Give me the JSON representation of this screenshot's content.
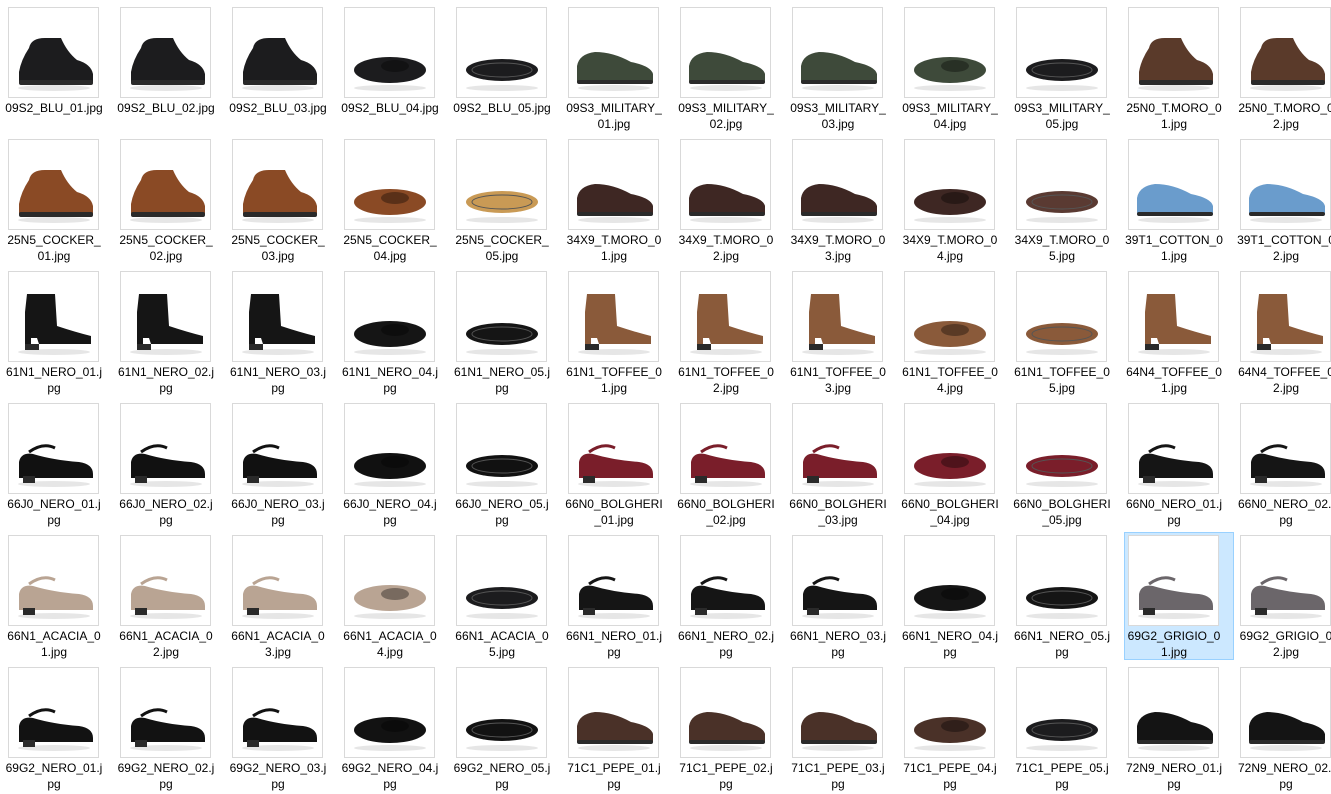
{
  "explorer": {
    "selected_file": "69G2_GRIGIO_01.jpg",
    "files": [
      {
        "name": "09S2_BLU_01.jpg",
        "icon": "black-ankle-boot-side-thumbnail",
        "color": "#1c1c1e"
      },
      {
        "name": "09S2_BLU_02.jpg",
        "icon": "black-ankle-boot-angle-thumbnail",
        "color": "#1c1c1e"
      },
      {
        "name": "09S2_BLU_03.jpg",
        "icon": "black-ankle-boot-front-thumbnail",
        "color": "#1c1c1e"
      },
      {
        "name": "09S2_BLU_04.jpg",
        "icon": "black-ankle-boot-top-thumbnail",
        "color": "#1c1c1e"
      },
      {
        "name": "09S2_BLU_05.jpg",
        "icon": "black-ankle-boot-sole-thumbnail",
        "color": "#1c1c1e"
      },
      {
        "name": "09S3_MILITARY_01.jpg",
        "icon": "green-sneaker-side-thumbnail",
        "color": "#3e4a3a"
      },
      {
        "name": "09S3_MILITARY_02.jpg",
        "icon": "green-sneaker-angle-thumbnail",
        "color": "#3e4a3a"
      },
      {
        "name": "09S3_MILITARY_03.jpg",
        "icon": "green-sneaker-front-thumbnail",
        "color": "#3e4a3a"
      },
      {
        "name": "09S3_MILITARY_04.jpg",
        "icon": "green-sneaker-top-thumbnail",
        "color": "#3e4a3a"
      },
      {
        "name": "09S3_MILITARY_05.jpg",
        "icon": "green-sneaker-sole-thumbnail",
        "color": "#1c1c1e"
      },
      {
        "name": "25N0_T.MORO_01.jpg",
        "icon": "brown-desert-boot-side-thumbnail",
        "color": "#5a3a2a"
      },
      {
        "name": "25N0_T.MORO_02.jpg",
        "icon": "brown-desert-boot-angle-thumbnail",
        "color": "#5a3a2a"
      },
      {
        "name": "25N5_COCKER_01.jpg",
        "icon": "cognac-lace-boot-side-thumbnail",
        "color": "#8a4a25"
      },
      {
        "name": "25N5_COCKER_02.jpg",
        "icon": "cognac-lace-boot-angle-thumbnail",
        "color": "#8a4a25"
      },
      {
        "name": "25N5_COCKER_03.jpg",
        "icon": "cognac-lace-boot-front-thumbnail",
        "color": "#8a4a25"
      },
      {
        "name": "25N5_COCKER_04.jpg",
        "icon": "cognac-lace-boot-top-thumbnail",
        "color": "#8a4a25"
      },
      {
        "name": "25N5_COCKER_05.jpg",
        "icon": "cognac-lace-boot-sole-thumbnail",
        "color": "#c99a55"
      },
      {
        "name": "34X9_T.MORO_01.jpg",
        "icon": "woven-tassel-loafer-side-thumbnail",
        "color": "#3e2723"
      },
      {
        "name": "34X9_T.MORO_02.jpg",
        "icon": "woven-tassel-loafer-angle-thumbnail",
        "color": "#3e2723"
      },
      {
        "name": "34X9_T.MORO_03.jpg",
        "icon": "woven-tassel-loafer-front-thumbnail",
        "color": "#3e2723"
      },
      {
        "name": "34X9_T.MORO_04.jpg",
        "icon": "woven-tassel-loafer-top-thumbnail",
        "color": "#3e2723"
      },
      {
        "name": "34X9_T.MORO_05.jpg",
        "icon": "woven-tassel-loafer-sole-thumbnail",
        "color": "#5a3a32"
      },
      {
        "name": "39T1_COTTON_01.jpg",
        "icon": "blue-platform-sneaker-side-thumbnail",
        "color": "#6a9ccc"
      },
      {
        "name": "39T1_COTTON_02.jpg",
        "icon": "blue-platform-sneaker-angle-thumbnail",
        "color": "#6a9ccc"
      },
      {
        "name": "61N1_NERO_01.jpg",
        "icon": "black-heeled-bootie-side-thumbnail",
        "color": "#151515"
      },
      {
        "name": "61N1_NERO_02.jpg",
        "icon": "black-heeled-bootie-angle-thumbnail",
        "color": "#151515"
      },
      {
        "name": "61N1_NERO_03.jpg",
        "icon": "black-heeled-bootie-front-thumbnail",
        "color": "#151515"
      },
      {
        "name": "61N1_NERO_04.jpg",
        "icon": "black-heeled-bootie-top-thumbnail",
        "color": "#151515"
      },
      {
        "name": "61N1_NERO_05.jpg",
        "icon": "black-heeled-bootie-sole-thumbnail",
        "color": "#151515"
      },
      {
        "name": "61N1_TOFFEE_01.jpg",
        "icon": "toffee-heeled-bootie-side-thumbnail",
        "color": "#8a5a3a"
      },
      {
        "name": "61N1_TOFFEE_02.jpg",
        "icon": "toffee-heeled-bootie-angle-thumbnail",
        "color": "#8a5a3a"
      },
      {
        "name": "61N1_TOFFEE_03.jpg",
        "icon": "toffee-heeled-bootie-front-thumbnail",
        "color": "#8a5a3a"
      },
      {
        "name": "61N1_TOFFEE_04.jpg",
        "icon": "toffee-heeled-bootie-top-thumbnail",
        "color": "#8a5a3a"
      },
      {
        "name": "61N1_TOFFEE_05.jpg",
        "icon": "toffee-heeled-bootie-sole-thumbnail",
        "color": "#8a5a3a"
      },
      {
        "name": "64N4_TOFFEE_01.jpg",
        "icon": "toffee-kitten-heel-bootie-side-thumbnail",
        "color": "#8a5a3a"
      },
      {
        "name": "64N4_TOFFEE_02.jpg",
        "icon": "toffee-kitten-heel-bootie-angle-thumbnail",
        "color": "#8a5a3a"
      },
      {
        "name": "66J0_NERO_01.jpg",
        "icon": "black-patent-strap-pump-side-thumbnail",
        "color": "#111111"
      },
      {
        "name": "66J0_NERO_02.jpg",
        "icon": "black-patent-strap-pump-angle-thumbnail",
        "color": "#111111"
      },
      {
        "name": "66J0_NERO_03.jpg",
        "icon": "black-patent-strap-pump-front-thumbnail",
        "color": "#111111"
      },
      {
        "name": "66J0_NERO_04.jpg",
        "icon": "black-patent-strap-pump-top-thumbnail",
        "color": "#111111"
      },
      {
        "name": "66J0_NERO_05.jpg",
        "icon": "black-patent-strap-pump-sole-thumbnail",
        "color": "#111111"
      },
      {
        "name": "66N0_BOLGHERI_01.jpg",
        "icon": "burgundy-strap-pump-side-thumbnail",
        "color": "#7a1e2a"
      },
      {
        "name": "66N0_BOLGHERI_02.jpg",
        "icon": "burgundy-strap-pump-angle-thumbnail",
        "color": "#7a1e2a"
      },
      {
        "name": "66N0_BOLGHERI_03.jpg",
        "icon": "burgundy-strap-pump-front-thumbnail",
        "color": "#7a1e2a"
      },
      {
        "name": "66N0_BOLGHERI_04.jpg",
        "icon": "burgundy-strap-pump-top-thumbnail",
        "color": "#7a1e2a"
      },
      {
        "name": "66N0_BOLGHERI_05.jpg",
        "icon": "burgundy-strap-pump-sole-thumbnail",
        "color": "#7a1e2a"
      },
      {
        "name": "66N0_NERO_01.jpg",
        "icon": "black-strap-pump-side-thumbnail",
        "color": "#151515"
      },
      {
        "name": "66N0_NERO_02.jpg",
        "icon": "black-strap-pump-angle-thumbnail",
        "color": "#151515"
      },
      {
        "name": "66N1_ACACIA_01.jpg",
        "icon": "beige-double-strap-pump-side-thumbnail",
        "color": "#b9a493"
      },
      {
        "name": "66N1_ACACIA_02.jpg",
        "icon": "beige-double-strap-pump-angle-thumbnail",
        "color": "#b9a493"
      },
      {
        "name": "66N1_ACACIA_03.jpg",
        "icon": "beige-double-strap-pump-front-thumbnail",
        "color": "#b9a493"
      },
      {
        "name": "66N1_ACACIA_04.jpg",
        "icon": "beige-double-strap-pump-top-thumbnail",
        "color": "#b9a493"
      },
      {
        "name": "66N1_ACACIA_05.jpg",
        "icon": "beige-double-strap-pump-sole-thumbnail",
        "color": "#1c1c1e"
      },
      {
        "name": "66N1_NERO_01.jpg",
        "icon": "black-double-strap-pump-side-thumbnail",
        "color": "#151515"
      },
      {
        "name": "66N1_NERO_02.jpg",
        "icon": "black-double-strap-pump-angle-thumbnail",
        "color": "#151515"
      },
      {
        "name": "66N1_NERO_03.jpg",
        "icon": "black-double-strap-pump-front-thumbnail",
        "color": "#151515"
      },
      {
        "name": "66N1_NERO_04.jpg",
        "icon": "black-double-strap-pump-top-thumbnail",
        "color": "#151515"
      },
      {
        "name": "66N1_NERO_05.jpg",
        "icon": "black-double-strap-pump-sole-thumbnail",
        "color": "#151515"
      },
      {
        "name": "69G2_GRIGIO_01.jpg",
        "icon": "grey-velvet-ballet-flat-side-thumbnail",
        "color": "#6b666a"
      },
      {
        "name": "69G2_GRIGIO_02.jpg",
        "icon": "grey-velvet-ballet-flat-angle-thumbnail",
        "color": "#6b666a"
      },
      {
        "name": "69G2_NERO_01.jpg",
        "icon": "black-velvet-ballet-flat-side-thumbnail",
        "color": "#121212"
      },
      {
        "name": "69G2_NERO_02.jpg",
        "icon": "black-velvet-ballet-flat-angle-thumbnail",
        "color": "#121212"
      },
      {
        "name": "69G2_NERO_03.jpg",
        "icon": "black-velvet-ballet-flat-front-thumbnail",
        "color": "#121212"
      },
      {
        "name": "69G2_NERO_04.jpg",
        "icon": "black-velvet-ballet-flat-top-thumbnail",
        "color": "#121212"
      },
      {
        "name": "69G2_NERO_05.jpg",
        "icon": "black-velvet-ballet-flat-sole-thumbnail",
        "color": "#121212"
      },
      {
        "name": "71C1_PEPE_01.jpg",
        "icon": "brown-suede-penny-loafer-side-thumbnail",
        "color": "#4a3128"
      },
      {
        "name": "71C1_PEPE_02.jpg",
        "icon": "brown-suede-penny-loafer-angle-thumbnail",
        "color": "#4a3128"
      },
      {
        "name": "71C1_PEPE_03.jpg",
        "icon": "brown-suede-penny-loafer-front-thumbnail",
        "color": "#4a3128"
      },
      {
        "name": "71C1_PEPE_04.jpg",
        "icon": "brown-suede-penny-loafer-top-thumbnail",
        "color": "#4a3128"
      },
      {
        "name": "71C1_PEPE_05.jpg",
        "icon": "brown-suede-penny-loafer-sole-thumbnail",
        "color": "#1c1c1e"
      },
      {
        "name": "72N9_NERO_01.jpg",
        "icon": "black-derby-shoe-side-thumbnail",
        "color": "#141414"
      },
      {
        "name": "72N9_NERO_02.jpg",
        "icon": "black-derby-shoe-angle-thumbnail",
        "color": "#141414"
      }
    ]
  }
}
